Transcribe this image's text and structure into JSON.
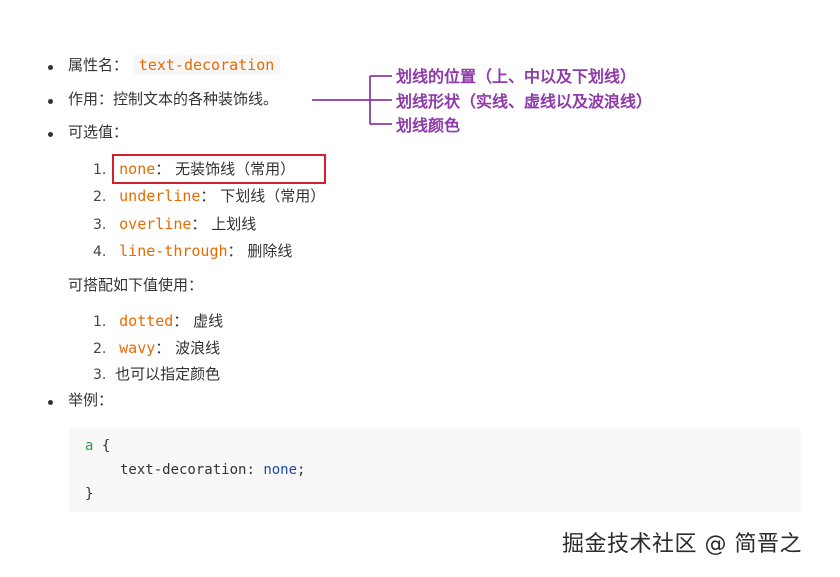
{
  "property": {
    "label": "属性名：",
    "value": "text-decoration"
  },
  "purpose": {
    "label": "作用：",
    "text": "控制文本的各种装饰线。"
  },
  "options": {
    "label": "可选值："
  },
  "values": [
    {
      "num": "1.",
      "code": "none",
      "sep": "：",
      "desc": "无装饰线（常用）"
    },
    {
      "num": "2.",
      "code": "underline",
      "sep": "：",
      "desc": "下划线（常用）"
    },
    {
      "num": "3.",
      "code": "overline",
      "sep": "：",
      "desc": "上划线"
    },
    {
      "num": "4.",
      "code": "line-through",
      "sep": "：",
      "desc": "删除线"
    }
  ],
  "combo": {
    "label": "可搭配如下值使用："
  },
  "combo_values": [
    {
      "num": "1.",
      "code": "dotted",
      "sep": "：",
      "desc": "虚线"
    },
    {
      "num": "2.",
      "code": "wavy",
      "sep": "：",
      "desc": "波浪线"
    },
    {
      "num": "3.",
      "code": "",
      "sep": "",
      "desc": "也可以指定颜色"
    }
  ],
  "example": {
    "label": "举例："
  },
  "code_block": {
    "line1_selector": "a",
    "line1_brace": "{",
    "line2_prop": "text-decoration",
    "line2_colon": ":",
    "line2_value": "none",
    "line2_semi": ";",
    "line3_brace": "}"
  },
  "annotations": [
    "划线的位置（上、中以及下划线）",
    "划线形状（实线、虚线以及波浪线）",
    "划线颜色"
  ],
  "watermark": "掘金技术社区 @ 简晋之",
  "colors": {
    "code_orange": "#e96900",
    "annotation_purple": "#8e3aa8",
    "highlight_red": "#d0222a",
    "code_keyword": "#2f9c4e",
    "code_value": "#1f4aa8"
  }
}
